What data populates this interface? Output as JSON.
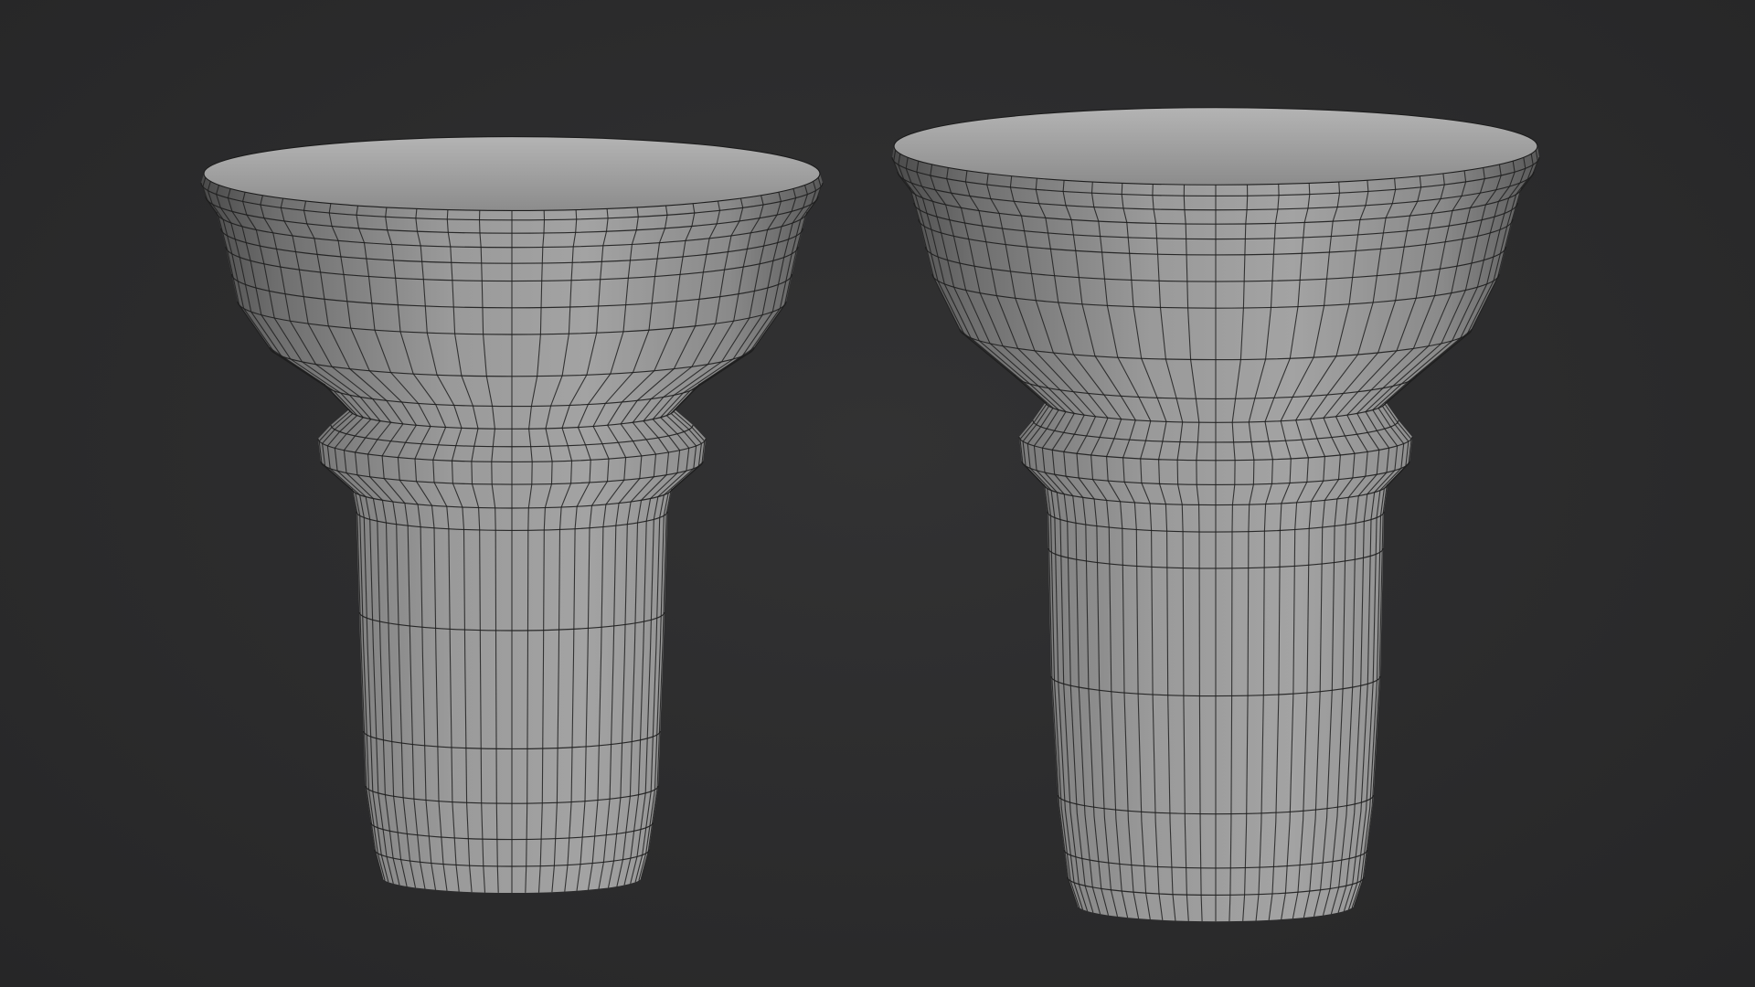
{
  "viewport": {
    "background": "#2b2b2c"
  },
  "models": [
    {
      "label": "",
      "shading": "solid-with-wireframe",
      "base_color": "#8a8a8a",
      "wire_color": "#1e1e1e"
    },
    {
      "label": "",
      "shading": "solid-with-wireframe",
      "base_color": "#8a8a8a",
      "wire_color": "#1e1e1e"
    }
  ]
}
